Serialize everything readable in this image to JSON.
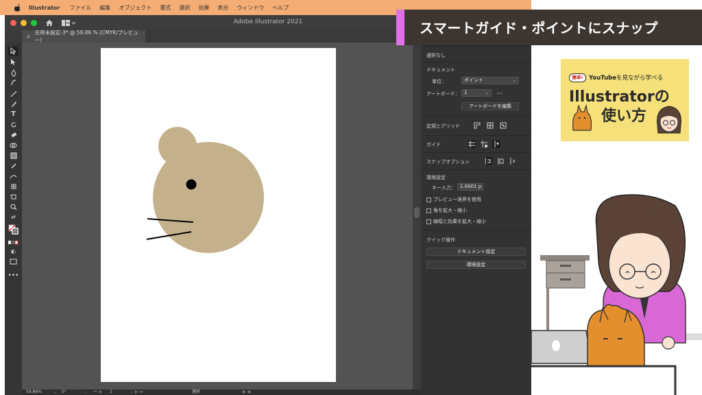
{
  "menubar": {
    "app_name": "Illustrator",
    "menus": [
      "ファイル",
      "編集",
      "オブジェクト",
      "書式",
      "選択",
      "効果",
      "表示",
      "ウィンドウ",
      "ヘルプ"
    ]
  },
  "window": {
    "title": "Adobe Illustrator 2021",
    "document_tab": "名称未設定-3* @ 59.86 % (CMYK/プレビュー)"
  },
  "statusbar": {
    "zoom": "59.86%",
    "rotation": "0°",
    "artboard_number": "1",
    "tool_status": "選択"
  },
  "properties_panel": {
    "selection_status": "選択なし",
    "document_heading": "ドキュメント",
    "units_label": "単位：",
    "units_value": "ポイント",
    "artboard_label": "アートボード：",
    "artboard_value": "1",
    "edit_artboards_button": "アートボードを編集",
    "rulers_grids_label": "定規とグリッド",
    "guides_label": "ガイド",
    "snap_options_label": "スナップオプション",
    "preferences_heading": "環境設定",
    "keyboard_increment_label": "キー入力：",
    "keyboard_increment_value": "1.0001 p",
    "use_preview_bounds": "プレビュー境界を使用",
    "scale_corners": "角を拡大・縮小",
    "scale_strokes_effects": "線幅と効果を拡大・縮小",
    "quick_actions_heading": "クイック操作",
    "document_setup_button": "ドキュメント設定",
    "preferences_button": "環境設定"
  },
  "banner": {
    "title": "スマートガイド・ポイントにスナップ"
  },
  "youtube_card": {
    "badge": "簡単!",
    "tagline_bold": "YouTube",
    "tagline_rest": "を見ながら学べる",
    "title_line1": "Illustratorの",
    "title_line2": "使い方"
  },
  "colors": {
    "menubar_bg": "#f4ad74",
    "banner_bg": "#3c3530",
    "banner_accent": "#e070e8",
    "card_bg": "#f5e079",
    "mouse_fill": "#c4b18c"
  },
  "icons": [
    "apple-icon",
    "home-icon",
    "workspace-icon",
    "selection-tool-icon",
    "pen-tool-icon",
    "type-tool-icon",
    "zoom-tool-icon",
    "ruler-icon",
    "grid-icon",
    "guides-icon",
    "snap-to-point-icon"
  ]
}
